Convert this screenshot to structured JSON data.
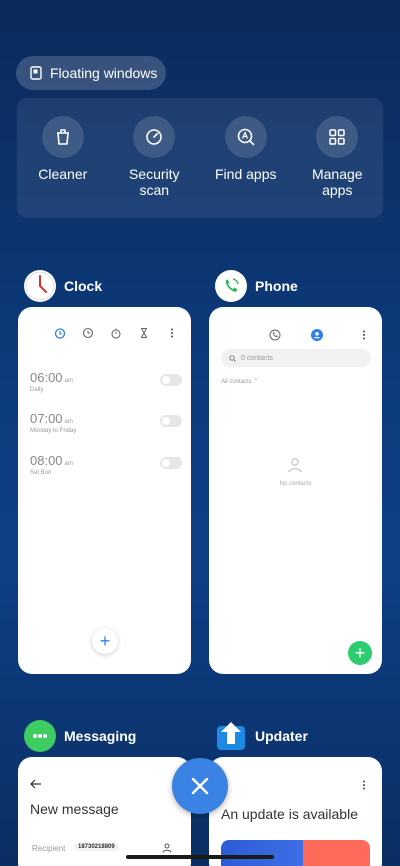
{
  "floating": {
    "label": "Floating windows",
    "icon": "floating-window-icon"
  },
  "quick_actions": [
    {
      "label": "Cleaner",
      "icon": "trash-icon"
    },
    {
      "label": "Security\nscan",
      "icon": "security-scan-icon"
    },
    {
      "label": "Find apps",
      "icon": "find-apps-icon"
    },
    {
      "label": "Manage\napps",
      "icon": "grid-icon"
    }
  ],
  "apps": {
    "clock": {
      "name": "Clock",
      "alarms": [
        {
          "time": "06:00",
          "ampm": "am",
          "sub": "Daily"
        },
        {
          "time": "07:00",
          "ampm": "am",
          "sub": "Monday to Friday"
        },
        {
          "time": "08:00",
          "ampm": "am",
          "sub": "Set Bon"
        }
      ],
      "fab": "+"
    },
    "phone": {
      "name": "Phone",
      "search_placeholder": "0 contacts",
      "filter": "All contacts",
      "empty": "No contacts",
      "fab": "+"
    },
    "messaging": {
      "name": "Messaging",
      "title": "New message",
      "recipient_label": "Recipient",
      "recipient_value": "18730218809"
    },
    "updater": {
      "name": "Updater",
      "title": "An update is available"
    }
  },
  "colors": {
    "accent": "#3a82e4",
    "green": "#2ecc71"
  }
}
